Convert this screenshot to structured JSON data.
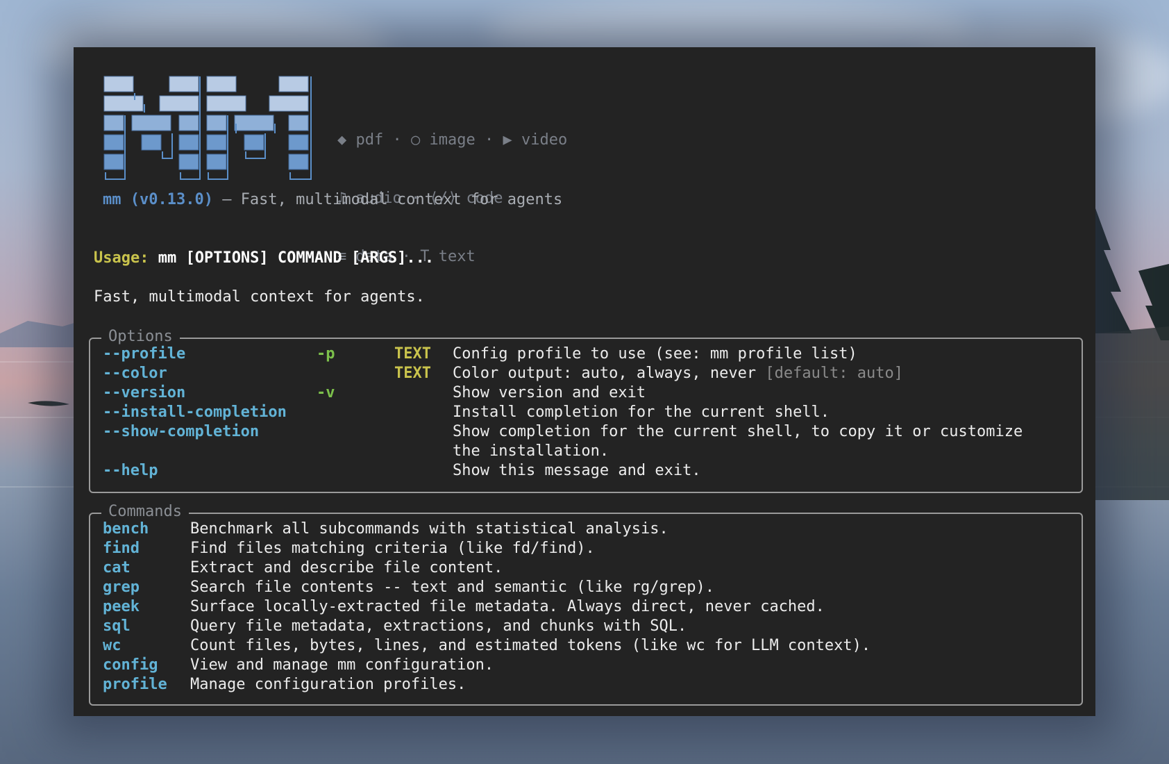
{
  "logo": {
    "alt_name": "mm-pixel-logo"
  },
  "media_types": [
    [
      {
        "icon": "◆",
        "label": "pdf"
      },
      {
        "icon": "○",
        "label": "image"
      },
      {
        "icon": "▶",
        "label": "video"
      }
    ],
    [
      {
        "icon": "♫",
        "label": "audio"
      },
      {
        "icon": "⟨/⟩",
        "label": "code"
      }
    ],
    [
      {
        "icon": "≡",
        "label": "data"
      },
      {
        "icon": "T",
        "label": "text"
      }
    ]
  ],
  "separator": "·",
  "tagline": {
    "name": "mm (v0.13.0)",
    "rest": " — Fast, multimodal context for agents"
  },
  "usage": {
    "label": "Usage:",
    "text": " mm [OPTIONS] COMMAND [ARGS]..."
  },
  "description": "Fast, multimodal context for agents.",
  "options": {
    "title": "Options",
    "rows": [
      {
        "flag": "--profile",
        "short": "-p",
        "type": "TEXT",
        "help": "Config profile to use (see: mm profile list)",
        "default": ""
      },
      {
        "flag": "--color",
        "short": "",
        "type": "TEXT",
        "help": "Color output: auto, always, never",
        "default": "[default: auto]"
      },
      {
        "flag": "--version",
        "short": "-v",
        "type": "",
        "help": "Show version and exit",
        "default": ""
      },
      {
        "flag": "--install-completion",
        "short": "",
        "type": "",
        "help": "Install completion for the current shell.",
        "default": ""
      },
      {
        "flag": "--show-completion",
        "short": "",
        "type": "",
        "help": "Show completion for the current shell, to copy it or customize",
        "default": ""
      },
      {
        "flag": "",
        "short": "",
        "type": "",
        "help": "the installation.",
        "default": ""
      },
      {
        "flag": "--help",
        "short": "",
        "type": "",
        "help": "Show this message and exit.",
        "default": ""
      }
    ]
  },
  "commands": {
    "title": "Commands",
    "rows": [
      {
        "name": "bench",
        "help": "Benchmark all subcommands with statistical analysis."
      },
      {
        "name": "find",
        "help": "Find files matching criteria (like fd/find)."
      },
      {
        "name": "cat",
        "help": "Extract and describe file content."
      },
      {
        "name": "grep",
        "help": "Search file contents -- text and semantic (like rg/grep)."
      },
      {
        "name": "peek",
        "help": "Surface locally-extracted file metadata. Always direct, never cached."
      },
      {
        "name": "sql",
        "help": "Query file metadata, extractions, and chunks with SQL."
      },
      {
        "name": "wc",
        "help": "Count files, bytes, lines, and estimated tokens (like wc for LLM context)."
      },
      {
        "name": "config",
        "help": "View and manage mm configuration."
      },
      {
        "name": "profile",
        "help": "Manage configuration profiles."
      }
    ]
  },
  "colors": {
    "terminal_bg": "#232323",
    "flag": "#62b3d6",
    "short_flag": "#7cc04b",
    "type": "#c9c34c",
    "usage_label": "#c9c34c",
    "logo_blue": "#5b8fc9"
  }
}
